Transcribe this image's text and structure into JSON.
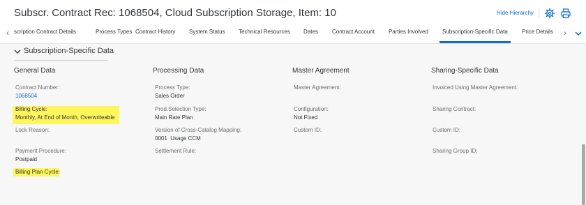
{
  "header": {
    "title": "Subscr. Contract Rec: 1068504, Cloud Subscription Storage, Item: 10",
    "hide_hierarchy": "Hide Hierarchy",
    "settings_icon": "gear-icon",
    "print_icon": "print-icon"
  },
  "tabs": {
    "items": [
      "scription Contract Details",
      "Process Types",
      "Contract History",
      "System Status",
      "Technical Resources",
      "Dates",
      "Contract Account",
      "Parties Involved",
      "Subscription-Specific Data",
      "Price Details"
    ],
    "selected": "Subscription-Specific Data",
    "accent_color": "#0a6ed1"
  },
  "section": {
    "title": "Subscription-Specific Data"
  },
  "columns": {
    "general": {
      "heading": "General Data",
      "contract_number_label": "Contract Number:",
      "contract_number_value": "1068504",
      "billing_cycle_label": "Billing Cycle:",
      "billing_cycle_value": "Monthly, At End of Month, Overwriteable",
      "lock_reason_label": "Lock Reason:",
      "payment_procedure_label": "Payment Procedure:",
      "payment_procedure_value": "Postpaid",
      "billing_plan_cycle_label": "Billing Plan Cycle:"
    },
    "processing": {
      "heading": "Processing Data",
      "process_type_label": "Process Type:",
      "process_type_value": "Sales Order",
      "prod_selection_type_label": "Prod.Selection Type:",
      "prod_selection_type_value": "Main Rate Plan",
      "version_mapping_label": "Version of Cross-Catalog Mapping:",
      "version_mapping_value": "0001  Usage CCM",
      "settlement_rule_label": "Settlement Rule:"
    },
    "master": {
      "heading": "Master Agreement",
      "master_agreement_label": "Master Agreement:",
      "configuration_label": "Configuration:",
      "configuration_value": "Not Fixed",
      "custom_id_label": "Custom ID:"
    },
    "sharing": {
      "heading": "Sharing-Specific Data",
      "invoiced_label": "Invoiced Using Master Agreement:",
      "sharing_contract_label": "Sharing Contract:",
      "custom_id_label": "Custom ID:",
      "sharing_group_id_label": "Sharing Group ID:"
    }
  },
  "highlight_color": "#fff65c"
}
